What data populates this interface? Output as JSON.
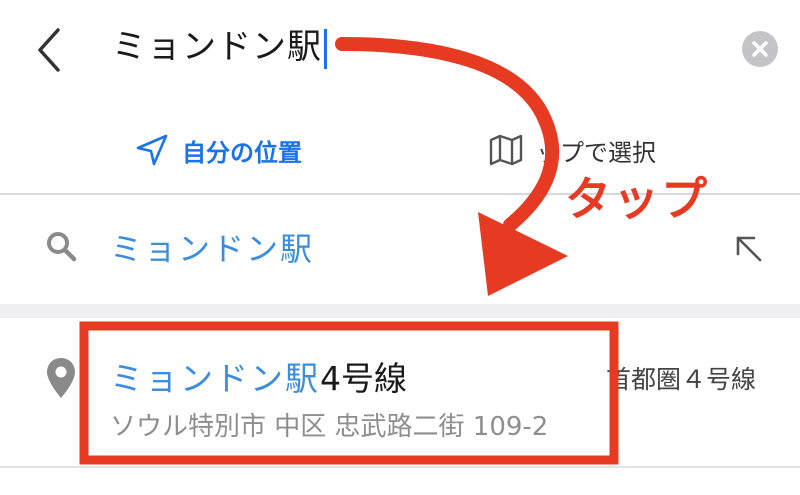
{
  "search": {
    "query": "ミョンドン駅"
  },
  "options": {
    "my_location": "自分の位置",
    "choose_on_map": "ップで選択"
  },
  "suggestion": {
    "text": "ミョンドン駅"
  },
  "result": {
    "name_highlight": "ミョンドン駅",
    "name_rest": "4号線",
    "line": "首都圏４号線",
    "address": "ソウル特別市 中区 忠武路二街 109-2"
  },
  "annotation": {
    "label": "タップ",
    "color": "#e63b22"
  },
  "colors": {
    "accent": "#1a73e8",
    "highlight": "#3d8ddf",
    "annotation_red": "#e63b22"
  }
}
